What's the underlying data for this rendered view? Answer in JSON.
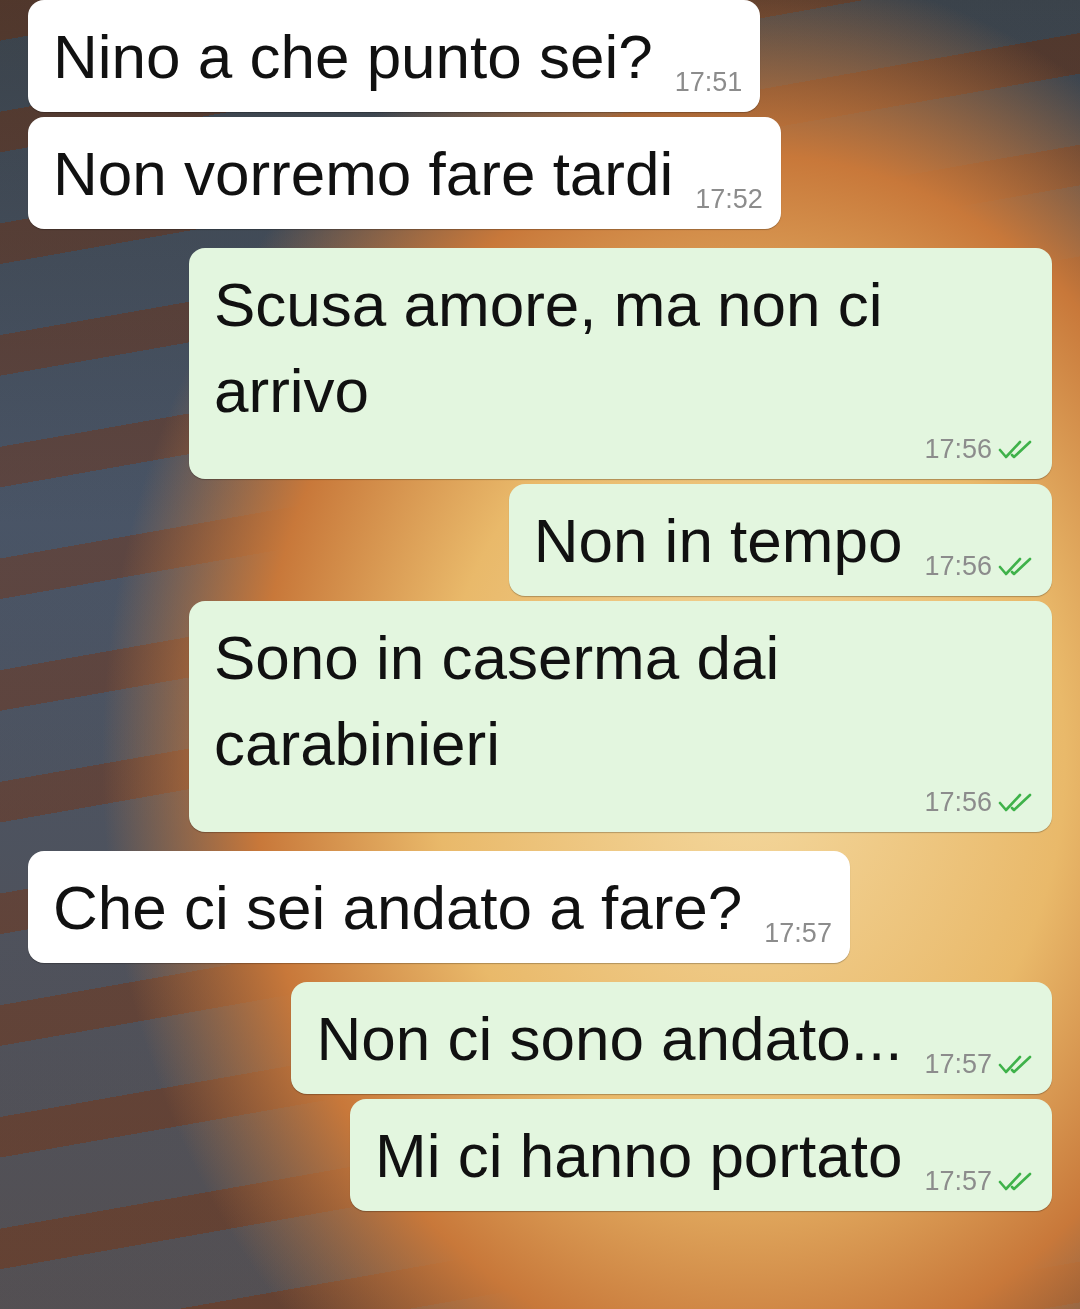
{
  "messages": [
    {
      "kind": "incoming",
      "text": "Nino a che punto sei?",
      "time": "17:51"
    },
    {
      "kind": "incoming",
      "text": "Non vorremo fare tardi",
      "time": "17:52"
    },
    {
      "kind": "outgoing",
      "text": "Scusa amore, ma non ci arrivo",
      "time": "17:56",
      "read": true
    },
    {
      "kind": "outgoing",
      "text": "Non in tempo",
      "time": "17:56",
      "read": true
    },
    {
      "kind": "outgoing",
      "text": "Sono in caserma dai carabinieri",
      "time": "17:56",
      "read": true
    },
    {
      "kind": "incoming",
      "text": "Che ci sei andato a fare?",
      "time": "17:57"
    },
    {
      "kind": "outgoing",
      "text": "Non ci sono andato...",
      "time": "17:57",
      "read": true
    },
    {
      "kind": "outgoing",
      "text": "Mi ci hanno portato",
      "time": "17:57",
      "read": true
    }
  ]
}
